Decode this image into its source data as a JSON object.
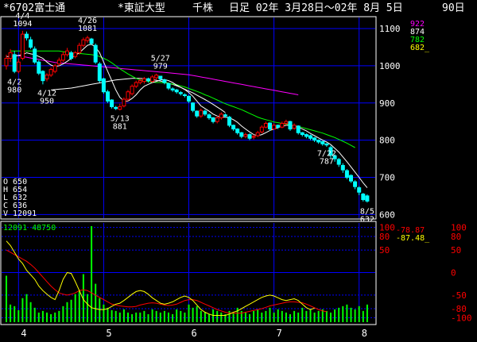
{
  "header": {
    "code_name": "*6702富士通",
    "market": "*東証大型",
    "unit": "千株",
    "period": "日足 02年 3月28日～02年 8月 5日",
    "days": "90日"
  },
  "colors": {
    "background": "#000000",
    "frame": "#ffffff",
    "grid": "#0000ff",
    "up_candle": "#ff0000",
    "down_candle": "#00ffff",
    "ma_short": "#ffffff",
    "ma_mid": "#00ff00",
    "ma_long": "#ff00ff",
    "ma_vlong": "#ffffff",
    "volume": "#00ff00",
    "osc_fast": "#ffff00",
    "osc_slow": "#ff0000",
    "label_text": "#ffffff",
    "legend_922": "#ff00ff",
    "legend_874": "#ffffff",
    "legend_782": "#00ff00",
    "legend_682": "#ffff00"
  },
  "ma_legend": [
    "922",
    "874",
    "782",
    "682_"
  ],
  "ohlcv": {
    "O": "O   650",
    "H": "H   654",
    "L": "L   632",
    "C": "C   636",
    "V": "V 12091"
  },
  "volume_readout": "12091 48750",
  "osc_readout": {
    "fast": "-78.87",
    "slow": "-87.48_"
  },
  "chart_data": {
    "type": "candlestick",
    "x_tick_labels": [
      "4",
      "5",
      "6",
      "7",
      "8"
    ],
    "x_tick_index": [
      3,
      24,
      45,
      66,
      87
    ],
    "price_axis": {
      "ticks": [
        600,
        700,
        800,
        900,
        1000,
        1100
      ],
      "range": [
        590,
        1130
      ]
    },
    "osc_axis": {
      "ticks_right": [
        "100",
        "80",
        "50",
        "0",
        "-50",
        "-80",
        "-100"
      ],
      "ticks_left": [
        "100",
        "80",
        "50"
      ],
      "range": [
        -110,
        110
      ]
    },
    "annotations": [
      {
        "date": "4/4",
        "value": "1094",
        "index": 4,
        "price": 1094,
        "pos": "above"
      },
      {
        "date": "4/26",
        "value": "1081",
        "index": 20,
        "price": 1081,
        "pos": "above"
      },
      {
        "date": "5/27",
        "value": "979",
        "index": 38,
        "price": 979,
        "pos": "above"
      },
      {
        "date": "4/2",
        "value": "980",
        "index": 2,
        "price": 980,
        "pos": "below"
      },
      {
        "date": "4/12",
        "value": "950",
        "index": 10,
        "price": 950,
        "pos": "below"
      },
      {
        "date": "5/13",
        "value": "881",
        "index": 28,
        "price": 881,
        "pos": "below"
      },
      {
        "date": "7/22",
        "value": "787",
        "index": 79,
        "price": 787,
        "pos": "below"
      },
      {
        "date": "8/5",
        "value": "632",
        "index": 89,
        "price": 632,
        "pos": "below"
      }
    ],
    "close": [
      1020,
      1035,
      985,
      1010,
      1085,
      1075,
      1050,
      1010,
      980,
      960,
      975,
      990,
      1000,
      1015,
      1030,
      1040,
      1020,
      1035,
      1055,
      1070,
      1075,
      1060,
      1010,
      960,
      930,
      905,
      890,
      885,
      890,
      910,
      930,
      945,
      955,
      960,
      965,
      960,
      970,
      975,
      965,
      955,
      940,
      935,
      930,
      925,
      920,
      905,
      880,
      865,
      880,
      870,
      860,
      850,
      860,
      870,
      865,
      840,
      830,
      820,
      810,
      815,
      805,
      810,
      820,
      835,
      845,
      830,
      840,
      835,
      845,
      850,
      830,
      840,
      820,
      815,
      810,
      805,
      800,
      795,
      790,
      787,
      760,
      750,
      735,
      720,
      700,
      690,
      675,
      660,
      640,
      636
    ],
    "open": [
      1000,
      1020,
      1030,
      985,
      1020,
      1085,
      1070,
      1045,
      1010,
      985,
      965,
      975,
      985,
      1005,
      1015,
      1030,
      1035,
      1025,
      1035,
      1055,
      1068,
      1072,
      1055,
      1005,
      965,
      930,
      908,
      888,
      883,
      892,
      910,
      925,
      945,
      955,
      958,
      965,
      958,
      968,
      972,
      962,
      952,
      938,
      935,
      928,
      922,
      918,
      900,
      878,
      865,
      878,
      868,
      860,
      850,
      860,
      868,
      862,
      840,
      830,
      820,
      810,
      815,
      808,
      812,
      822,
      835,
      846,
      830,
      840,
      835,
      845,
      850,
      832,
      838,
      820,
      815,
      812,
      806,
      800,
      796,
      790,
      780,
      758,
      748,
      732,
      718,
      705,
      688,
      672,
      655,
      650
    ],
    "high": [
      1030,
      1045,
      1040,
      1020,
      1094,
      1092,
      1078,
      1052,
      1015,
      988,
      980,
      995,
      1005,
      1022,
      1038,
      1048,
      1040,
      1040,
      1062,
      1076,
      1081,
      1075,
      1060,
      1010,
      968,
      935,
      910,
      892,
      898,
      915,
      935,
      950,
      960,
      966,
      970,
      968,
      975,
      979,
      972,
      965,
      955,
      942,
      938,
      932,
      926,
      920,
      902,
      880,
      885,
      882,
      872,
      862,
      865,
      875,
      872,
      865,
      842,
      832,
      822,
      820,
      818,
      815,
      825,
      840,
      850,
      848,
      845,
      842,
      850,
      855,
      852,
      845,
      840,
      822,
      818,
      815,
      808,
      802,
      798,
      792,
      785,
      762,
      752,
      738,
      722,
      708,
      692,
      676,
      658,
      654
    ],
    "low": [
      990,
      1010,
      980,
      980,
      1015,
      1068,
      1045,
      1005,
      975,
      950,
      958,
      970,
      980,
      1000,
      1010,
      1025,
      1015,
      1020,
      1030,
      1050,
      1062,
      1055,
      1005,
      955,
      925,
      900,
      885,
      881,
      880,
      888,
      905,
      920,
      940,
      950,
      952,
      955,
      955,
      962,
      960,
      950,
      935,
      930,
      925,
      920,
      915,
      900,
      875,
      860,
      860,
      865,
      855,
      845,
      845,
      855,
      860,
      835,
      825,
      815,
      805,
      805,
      800,
      802,
      808,
      818,
      832,
      825,
      828,
      830,
      832,
      840,
      825,
      828,
      815,
      810,
      805,
      800,
      795,
      790,
      785,
      782,
      752,
      742,
      728,
      712,
      695,
      685,
      668,
      652,
      635,
      632
    ],
    "ma_short": [
      1025,
      1025,
      1025,
      1028,
      1030,
      1035,
      1032,
      1030,
      1025,
      1020,
      1010,
      1002,
      998,
      1000,
      1005,
      1012,
      1020,
      1028,
      1035,
      1045,
      1055,
      1058,
      1050,
      1035,
      1010,
      985,
      960,
      935,
      915,
      905,
      905,
      912,
      922,
      935,
      945,
      950,
      955,
      958,
      962,
      963,
      960,
      955,
      948,
      942,
      936,
      928,
      918,
      905,
      892,
      885,
      878,
      870,
      865,
      862,
      862,
      860,
      855,
      848,
      838,
      830,
      822,
      815,
      812,
      815,
      820,
      826,
      830,
      834,
      837,
      840,
      840,
      838,
      835,
      830,
      825,
      818,
      812,
      806,
      800,
      795,
      788,
      778,
      768,
      755,
      742,
      728,
      714,
      700,
      685,
      672
    ],
    "ma_mid": [
      1040,
      1040,
      1040,
      1040,
      1040,
      1040,
      1040,
      1040,
      1040,
      1040,
      1040,
      1040,
      1040,
      1038,
      1036,
      1035,
      1034,
      1033,
      1032,
      1031,
      1030,
      1028,
      1025,
      1020,
      1015,
      1008,
      1000,
      992,
      985,
      978,
      972,
      966,
      962,
      960,
      958,
      956,
      955,
      955,
      954,
      953,
      951,
      949,
      946,
      943,
      939,
      935,
      931,
      927,
      922,
      918,
      913,
      908,
      903,
      898,
      894,
      890,
      886,
      882,
      877,
      872,
      867,
      862,
      858,
      855,
      852,
      849,
      847,
      845,
      843,
      841,
      839,
      837,
      834,
      831,
      828,
      825,
      822,
      819,
      815,
      811,
      807,
      802,
      797,
      792,
      786,
      780
    ],
    "ma_long": [
      1030,
      1029,
      1027,
      1025,
      1023,
      1021,
      1019,
      1017,
      1015,
      1013,
      1011,
      1009,
      1008,
      1007,
      1006,
      1005,
      1004,
      1003,
      1002,
      1001,
      1000,
      999,
      998,
      997,
      996,
      995,
      994,
      993,
      992,
      991,
      990,
      989,
      988,
      987,
      986,
      985,
      984,
      983,
      982,
      981,
      980,
      979,
      978,
      977,
      976,
      974,
      972,
      970,
      968,
      966,
      964,
      962,
      960,
      958,
      956,
      954,
      952,
      950,
      948,
      946,
      944,
      942,
      940,
      938,
      936,
      934,
      932,
      930,
      928,
      926,
      924,
      922
    ],
    "ma_vlong": [
      935,
      936,
      937,
      938,
      939,
      940,
      942,
      944,
      946,
      948,
      950,
      952,
      954,
      956,
      958,
      960,
      962,
      963,
      964,
      965,
      966,
      966,
      966,
      965,
      964,
      963,
      961,
      959,
      956,
      953,
      950,
      946,
      942,
      937,
      932,
      927,
      921,
      915,
      909,
      903,
      896,
      889,
      882,
      874
    ],
    "ma_long_start": 1,
    "ma_mid_start": 1,
    "ma_vlong_start": 11,
    "volume": [
      58,
      22,
      20,
      15,
      30,
      35,
      25,
      18,
      12,
      14,
      12,
      10,
      12,
      14,
      20,
      25,
      28,
      35,
      40,
      60,
      35,
      120,
      48,
      30,
      22,
      18,
      15,
      14,
      12,
      16,
      12,
      10,
      12,
      12,
      14,
      10,
      16,
      14,
      12,
      14,
      12,
      10,
      16,
      14,
      12,
      22,
      18,
      20,
      14,
      12,
      10,
      16,
      14,
      12,
      10,
      14,
      12,
      18,
      14,
      12,
      10,
      14,
      16,
      12,
      14,
      18,
      12,
      16,
      14,
      12,
      10,
      14,
      12,
      18,
      14,
      16,
      12,
      14,
      16,
      14,
      12,
      16,
      18,
      20,
      22,
      18,
      16,
      20,
      14,
      22
    ],
    "osc_fast": [
      70,
      60,
      45,
      30,
      20,
      5,
      -5,
      -15,
      -30,
      -40,
      -48,
      -55,
      -60,
      -40,
      -15,
      0,
      -2,
      -20,
      -40,
      -60,
      -70,
      -78,
      -80,
      -82,
      -82,
      -80,
      -75,
      -70,
      -68,
      -62,
      -55,
      -48,
      -42,
      -40,
      -42,
      -48,
      -56,
      -62,
      -68,
      -70,
      -68,
      -65,
      -60,
      -55,
      -52,
      -55,
      -62,
      -72,
      -82,
      -88,
      -92,
      -95,
      -95,
      -95,
      -95,
      -92,
      -88,
      -85,
      -80,
      -75,
      -70,
      -65,
      -60,
      -55,
      -52,
      -50,
      -52,
      -56,
      -60,
      -62,
      -60,
      -58,
      -62,
      -70,
      -78,
      -82,
      -79
    ],
    "osc_slow": [
      50,
      45,
      40,
      35,
      30,
      25,
      18,
      10,
      0,
      -10,
      -20,
      -30,
      -38,
      -45,
      -48,
      -50,
      -48,
      -45,
      -40,
      -38,
      -40,
      -45,
      -50,
      -55,
      -60,
      -65,
      -70,
      -72,
      -74,
      -75,
      -76,
      -76,
      -75,
      -72,
      -70,
      -68,
      -67,
      -68,
      -70,
      -72,
      -73,
      -72,
      -70,
      -66,
      -62,
      -60,
      -60,
      -62,
      -66,
      -70,
      -74,
      -78,
      -82,
      -85,
      -88,
      -90,
      -90,
      -90,
      -90,
      -88,
      -86,
      -84,
      -82,
      -80,
      -77,
      -74,
      -72,
      -70,
      -68,
      -66,
      -65,
      -65,
      -66,
      -67,
      -70,
      -74,
      -78,
      -82,
      -85,
      -87
    ],
    "osc_fast_start": 0,
    "osc_slow_start": 0
  }
}
